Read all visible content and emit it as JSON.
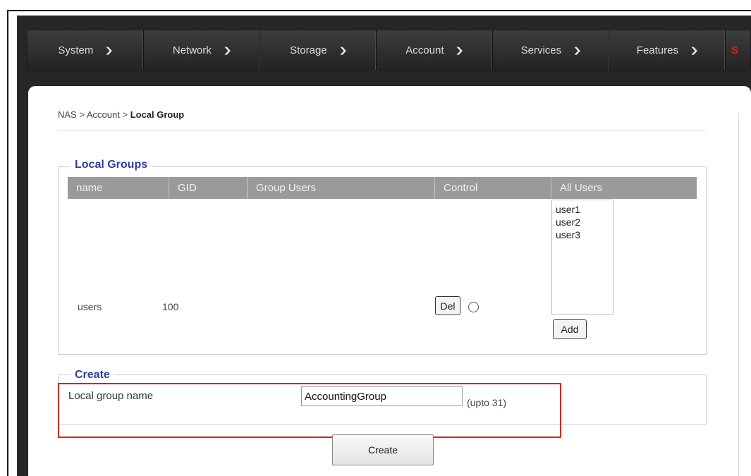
{
  "nav": {
    "items": [
      {
        "label": "System"
      },
      {
        "label": "Network"
      },
      {
        "label": "Storage"
      },
      {
        "label": "Account"
      },
      {
        "label": "Services"
      },
      {
        "label": "Features"
      }
    ],
    "overflow_label": "S"
  },
  "breadcrumb": {
    "root": "NAS",
    "separator": ">",
    "parent": "Account",
    "current": "Local Group"
  },
  "local_groups": {
    "legend": "Local Groups",
    "columns": [
      "name",
      "GID",
      "Group Users",
      "Control",
      "All Users"
    ],
    "rows": [
      {
        "name": "users",
        "gid": "100",
        "group_users": "",
        "del_label": "Del"
      }
    ],
    "all_users": [
      "user1",
      "user2",
      "user3"
    ],
    "add_label": "Add"
  },
  "create": {
    "legend": "Create",
    "field_label": "Local group name",
    "field_value": "AccountingGroup",
    "hint": "(upto 31)",
    "button_label": "Create"
  },
  "colors": {
    "accent_legend": "#2a3fa0",
    "highlight": "#d9231c",
    "nav_bg": "#2d2d2d",
    "table_header": "#9a9a9a"
  }
}
